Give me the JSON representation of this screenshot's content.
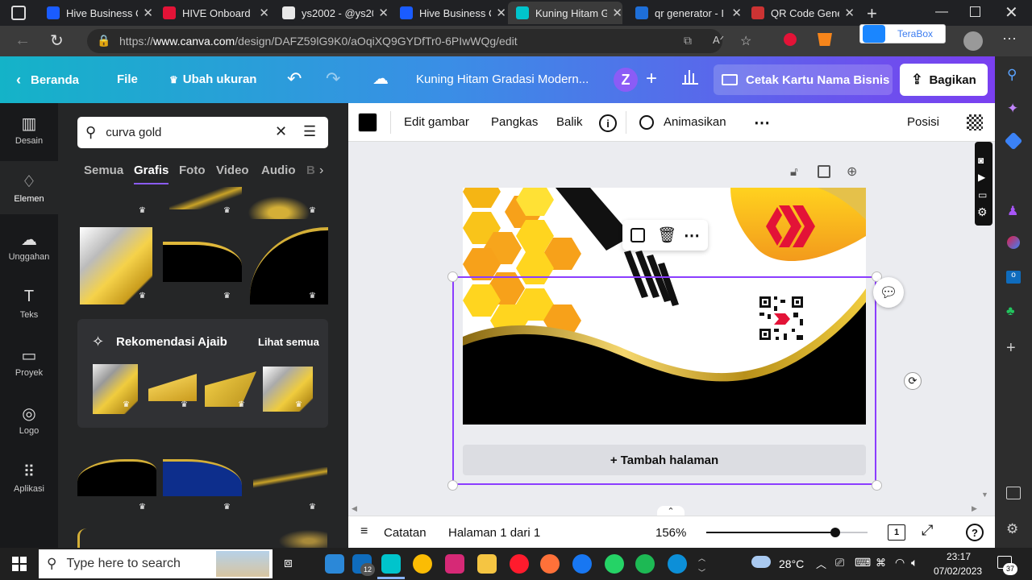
{
  "browser": {
    "tabs": [
      {
        "title": "Hive Business C",
        "color": "#1a5cff"
      },
      {
        "title": "HIVE Onboard",
        "color": "#e31337"
      },
      {
        "title": "ys2002 - @ys20",
        "color": "#e8e8e8"
      },
      {
        "title": "Hive Business C",
        "color": "#1a5cff"
      },
      {
        "title": "Kuning Hitam G",
        "color": "#00c4cc"
      },
      {
        "title": "qr generator - I",
        "color": "#1e6fd9"
      },
      {
        "title": "QR Code Gene",
        "color": "#cc3333"
      }
    ],
    "url_prefix": "https://",
    "url_domain": "www.canva.com",
    "url_path": "/design/DAFZ59lG9K0/aOqiXQ9GYDfTr0-6PIwWQg/edit",
    "terabox": "TeraBox"
  },
  "header": {
    "home": "Beranda",
    "file": "File",
    "resize": "Ubah ukuran",
    "doc_title": "Kuning Hitam Gradasi Modern...",
    "avatar": "Z",
    "print": "Cetak Kartu Nama Bisnis",
    "share": "Bagikan"
  },
  "rail": [
    {
      "label": "Desain",
      "icon": "layout-icon"
    },
    {
      "label": "Elemen",
      "icon": "shapes-icon"
    },
    {
      "label": "Unggahan",
      "icon": "upload-icon"
    },
    {
      "label": "Teks",
      "icon": "text-icon"
    },
    {
      "label": "Proyek",
      "icon": "folder-icon"
    },
    {
      "label": "Logo",
      "icon": "logo-icon"
    },
    {
      "label": "Aplikasi",
      "icon": "apps-icon"
    }
  ],
  "panel": {
    "search_value": "curva gold",
    "categories": [
      "Semua",
      "Grafis",
      "Foto",
      "Video",
      "Audio",
      "B"
    ],
    "active_category": "Grafis",
    "rec_title": "Rekomendasi Ajaib",
    "rec_link": "Lihat semua"
  },
  "toolbar": {
    "edit": "Edit gambar",
    "crop": "Pangkas",
    "flip": "Balik",
    "animate": "Animasikan",
    "position": "Posisi",
    "color": "#000000"
  },
  "canvas": {
    "add_page": "+ Tambah halaman"
  },
  "footer": {
    "notes": "Catatan",
    "page": "Halaman 1 dari 1",
    "zoom": "156%",
    "zoom_fraction": 0.8,
    "page_count": "1"
  },
  "taskbar": {
    "search_placeholder": "Type here to search",
    "mail_badge": "12",
    "temp": "28°C",
    "time": "23:17",
    "date": "07/02/2023",
    "notif": "37"
  }
}
